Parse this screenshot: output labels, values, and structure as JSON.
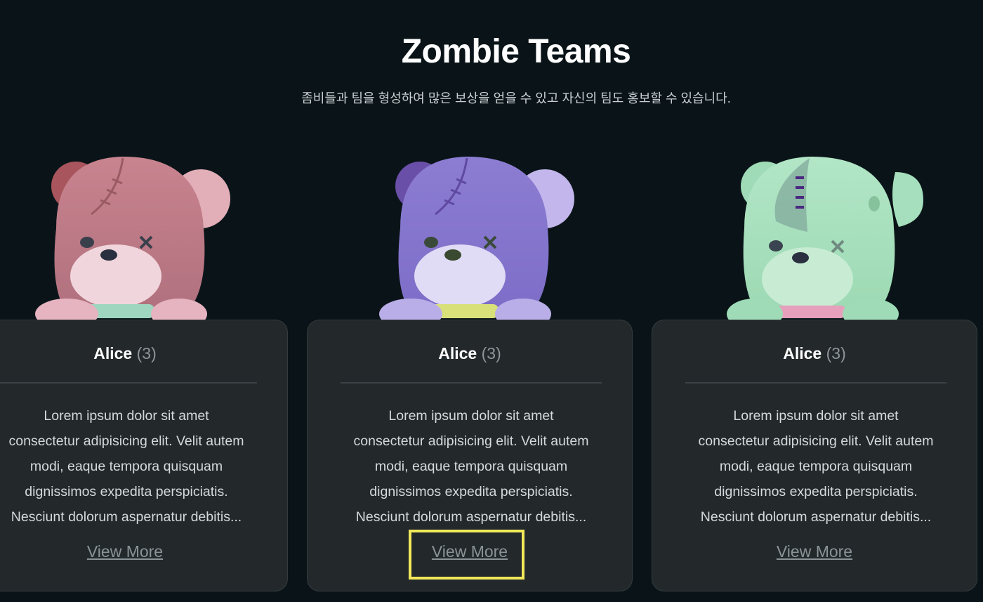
{
  "header": {
    "title": "Zombie Teams",
    "subtitle": "좀비들과 팀을 형성하여 많은 보상을 얻을 수 있고 자신의 팀도 홍보할 수 있습니다."
  },
  "teams": [
    {
      "name": "Alice",
      "count": "(3)",
      "desc_lines": [
        "Lorem ipsum dolor sit amet",
        "consectetur adipisicing elit. Velit autem",
        "modi, eaque tempora quisquam",
        "dignissimos expedita perspiciatis.",
        "Nesciunt dolorum aspernatur debitis..."
      ],
      "link": "View More",
      "avatar_icon": "pink-zombie-bear-icon",
      "bear_color": "#c07a88"
    },
    {
      "name": "Alice",
      "count": "(3)",
      "desc_lines": [
        "Lorem ipsum dolor sit amet",
        "consectetur adipisicing elit. Velit autem",
        "modi, eaque tempora quisquam",
        "dignissimos expedita perspiciatis.",
        "Nesciunt dolorum aspernatur debitis..."
      ],
      "link": "View More",
      "avatar_icon": "purple-zombie-bear-icon",
      "bear_color": "#8a7bd0"
    },
    {
      "name": "Alice",
      "count": "(3)",
      "desc_lines": [
        "Lorem ipsum dolor sit amet",
        "consectetur adipisicing elit. Velit autem",
        "modi, eaque tempora quisquam",
        "dignissimos expedita perspiciatis.",
        "Nesciunt dolorum aspernatur debitis..."
      ],
      "link": "View More",
      "avatar_icon": "green-zombie-bear-icon",
      "bear_color": "#a8e0bd"
    }
  ],
  "colors": {
    "background": "#0a1418",
    "card": "#23292b",
    "highlight": "#f1e85a"
  }
}
